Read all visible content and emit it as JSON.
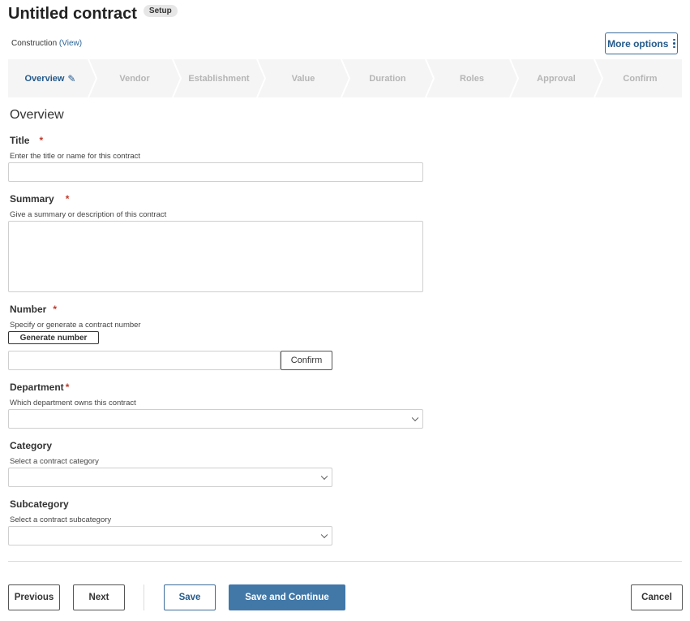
{
  "header": {
    "title": "Untitled contract",
    "badge": "Setup",
    "context": "Construction",
    "context_link": "(View)",
    "more_options": "More options"
  },
  "steps": [
    {
      "label": "Overview",
      "active": true
    },
    {
      "label": "Vendor",
      "active": false
    },
    {
      "label": "Establishment",
      "active": false
    },
    {
      "label": "Value",
      "active": false
    },
    {
      "label": "Duration",
      "active": false
    },
    {
      "label": "Roles",
      "active": false
    },
    {
      "label": "Approval",
      "active": false
    },
    {
      "label": "Confirm",
      "active": false
    }
  ],
  "form": {
    "section_title": "Overview",
    "required_mark": "*",
    "title": {
      "label": "Title",
      "help": "Enter the title or name for this contract",
      "value": ""
    },
    "summary": {
      "label": "Summary",
      "help": "Give a summary or description of this contract",
      "value": ""
    },
    "number": {
      "label": "Number",
      "help": "Specify or generate a contract number",
      "generate_label": "Generate number",
      "value": "",
      "confirm_label": "Confirm"
    },
    "department": {
      "label": "Department",
      "help": "Which department owns this contract",
      "value": ""
    },
    "category": {
      "label": "Category",
      "help": "Select a contract category",
      "value": ""
    },
    "subcategory": {
      "label": "Subcategory",
      "help": "Select a contract subcategory",
      "value": ""
    }
  },
  "footer": {
    "previous": "Previous",
    "next": "Next",
    "save": "Save",
    "save_continue": "Save and Continue",
    "cancel": "Cancel"
  },
  "colors": {
    "accent": "#245a8a",
    "primary_button": "#4178a8",
    "required": "#c0392b",
    "stepper_background": "#f5f5f5"
  }
}
